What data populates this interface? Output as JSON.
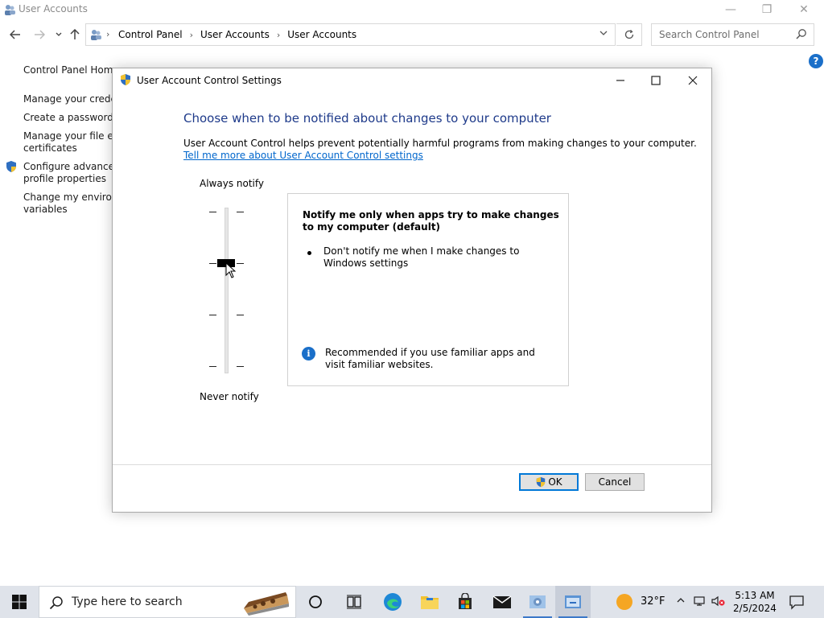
{
  "window": {
    "title": "User Accounts",
    "minimize": "—",
    "restore": "❐",
    "close": "✕"
  },
  "address": {
    "crumbs": [
      "Control Panel",
      "User Accounts",
      "User Accounts"
    ],
    "search_placeholder": "Search Control Panel"
  },
  "sidebar": {
    "home": "Control Panel Home",
    "links": [
      "Manage your credent",
      "Create a password re",
      "Manage your file enc",
      "certificates",
      "Configure advanced",
      "profile properties",
      "Change my environm",
      "variables"
    ]
  },
  "dialog": {
    "title": "User Account Control Settings",
    "heading": "Choose when to be notified about changes to your computer",
    "description": "User Account Control helps prevent potentially harmful programs from making changes to your computer.",
    "link": "Tell me more about User Account Control settings",
    "label_top": "Always notify",
    "label_bottom": "Never notify",
    "slider_level": 3,
    "slider_levels": 4,
    "panel": {
      "title": "Notify me only when apps try to make changes to my computer (default)",
      "bullet": "Don't notify me when I make changes to Windows settings",
      "recommendation": "Recommended if you use familiar apps and visit familiar websites."
    },
    "ok_label": "OK",
    "cancel_label": "Cancel"
  },
  "taskbar": {
    "search_placeholder": "Type here to search",
    "temperature": "32°F",
    "time": "5:13 AM",
    "date": "2/5/2024",
    "apps": [
      "task-view",
      "edge",
      "file-explorer",
      "microsoft-store",
      "mail",
      "control-panel",
      "uac-settings"
    ]
  }
}
